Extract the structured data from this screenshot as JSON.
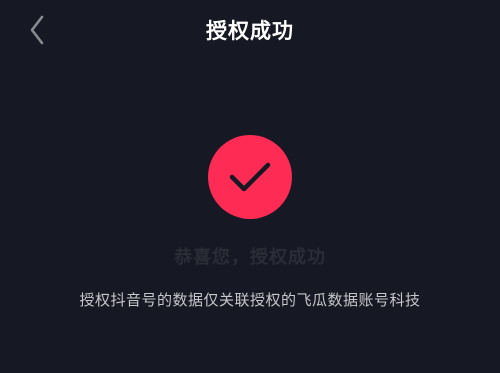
{
  "header": {
    "title": "授权成功",
    "back_icon": "chevron-left-icon"
  },
  "status": {
    "icon": "checkmark-icon",
    "circle_color": "#fe2c55",
    "headline": "恭喜您，授权成功",
    "description": "授权抖音号的数据仅关联授权的飞瓜数据账号科技"
  },
  "colors": {
    "background": "#161823",
    "accent": "#fe2c55"
  }
}
